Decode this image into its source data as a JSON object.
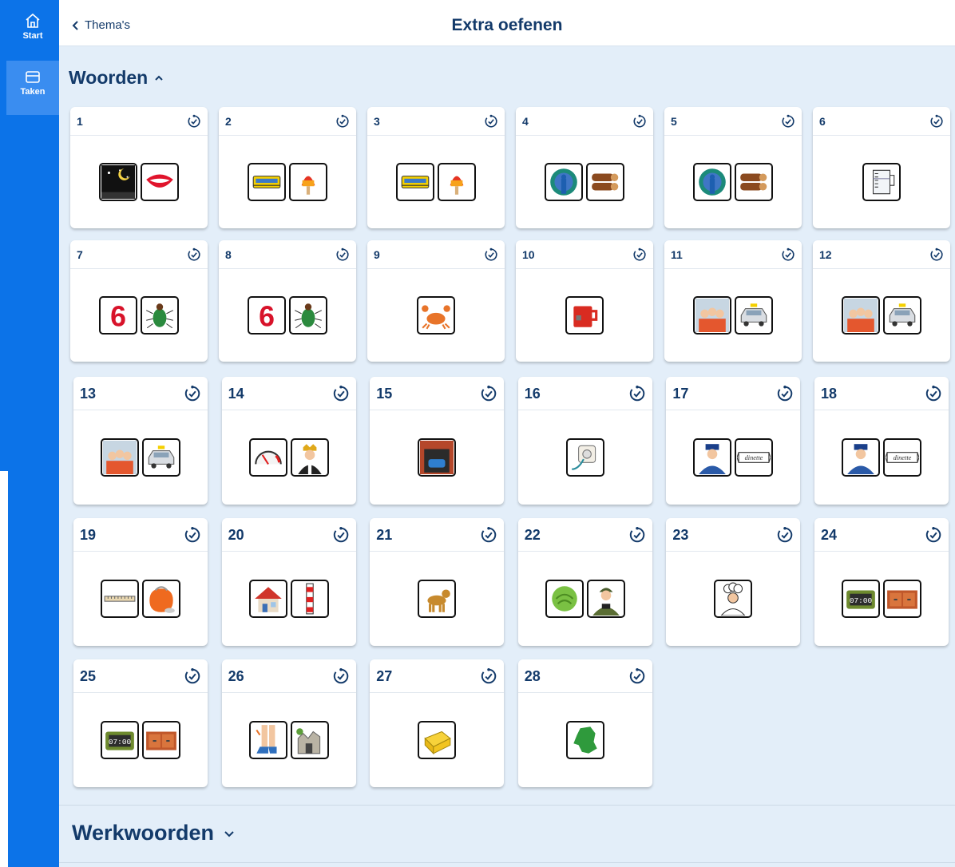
{
  "sidebar": {
    "items": [
      {
        "label": "Start",
        "icon": "home-icon"
      },
      {
        "label": "Taken",
        "icon": "tasks-icon",
        "active": true
      }
    ]
  },
  "header": {
    "back_label": "Thema's",
    "title": "Extra oefenen"
  },
  "sections": [
    {
      "title": "Woorden",
      "toggle_icon": "chevron-up-icon",
      "expanded": true
    },
    {
      "title": "Werkwoorden",
      "toggle_icon": "chevron-down-icon",
      "expanded": false
    }
  ],
  "exercises": [
    {
      "number": "1",
      "pictures": [
        "night-icon",
        "lips-icon"
      ]
    },
    {
      "number": "2",
      "pictures": [
        "tram-icon",
        "ice-lolly-icon"
      ]
    },
    {
      "number": "3",
      "pictures": [
        "tram-icon",
        "ice-lolly-icon"
      ]
    },
    {
      "number": "4",
      "pictures": [
        "peacock-icon",
        "logs-icon"
      ]
    },
    {
      "number": "5",
      "pictures": [
        "peacock-icon",
        "logs-icon"
      ]
    },
    {
      "number": "6",
      "pictures": [
        "measuring-cup-icon"
      ]
    },
    {
      "number": "7",
      "pictures": [
        "number-six-icon",
        "beetle-icon"
      ]
    },
    {
      "number": "8",
      "pictures": [
        "number-six-icon",
        "beetle-icon"
      ]
    },
    {
      "number": "9",
      "pictures": [
        "crab-icon"
      ]
    },
    {
      "number": "10",
      "pictures": [
        "mug-icon"
      ]
    },
    {
      "number": "11",
      "pictures": [
        "group-photo-icon",
        "taxi-icon"
      ]
    },
    {
      "number": "12",
      "pictures": [
        "group-photo-icon",
        "taxi-icon"
      ]
    },
    {
      "number": "13",
      "pictures": [
        "group-photo-icon",
        "taxi-icon"
      ]
    },
    {
      "number": "14",
      "pictures": [
        "speedometer-icon",
        "king-icon"
      ]
    },
    {
      "number": "15",
      "pictures": [
        "garage-icon"
      ]
    },
    {
      "number": "16",
      "pictures": [
        "power-socket-icon"
      ]
    },
    {
      "number": "17",
      "pictures": [
        "conductor-icon",
        "label-icon"
      ]
    },
    {
      "number": "18",
      "pictures": [
        "conductor-icon",
        "label-icon"
      ]
    },
    {
      "number": "19",
      "pictures": [
        "ruler-icon",
        "purse-icon"
      ]
    },
    {
      "number": "20",
      "pictures": [
        "house-icon",
        "pole-icon"
      ]
    },
    {
      "number": "21",
      "pictures": [
        "dog-icon"
      ]
    },
    {
      "number": "22",
      "pictures": [
        "cabbage-icon",
        "soldier-icon"
      ]
    },
    {
      "number": "23",
      "pictures": [
        "chef-icon"
      ]
    },
    {
      "number": "24",
      "pictures": [
        "alarm-clock-icon",
        "drawers-icon"
      ]
    },
    {
      "number": "25",
      "pictures": [
        "alarm-clock-icon",
        "drawers-icon"
      ]
    },
    {
      "number": "26",
      "pictures": [
        "legs-icon",
        "ruin-icon"
      ]
    },
    {
      "number": "27",
      "pictures": [
        "butter-icon"
      ]
    },
    {
      "number": "28",
      "pictures": [
        "netherlands-map-icon"
      ]
    }
  ],
  "glyph_text": {
    "clock": "07:00",
    "number_six": "6",
    "label": "dinette"
  },
  "colors": {
    "sidebar": "#0c73e8",
    "sidebar_active": "#3a8df0",
    "page_bg": "#e3eef9",
    "heading": "#133a6a",
    "card": "#ffffff"
  }
}
